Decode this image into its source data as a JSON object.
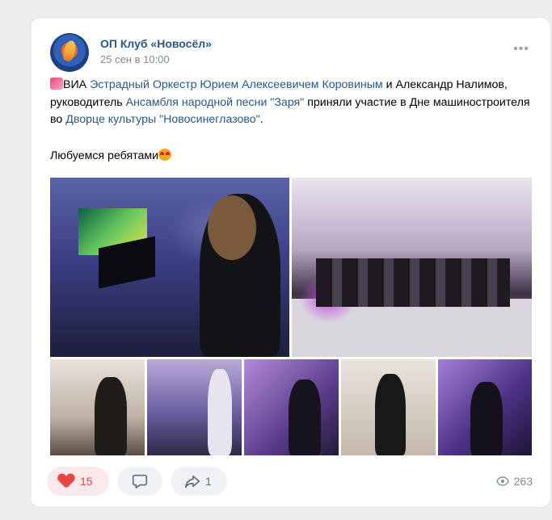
{
  "post": {
    "author": "ОП Клуб «Новосёл»",
    "date": "25 сен в 10:00",
    "more": "•••",
    "text": {
      "part1": "ВИА ",
      "link1": "Эстрадный Оркестр Юрием Алексеевичем Коровиным",
      "part2": " и Александр Налимов, руководитель ",
      "link2": "Ансамбля народной песни \"Заря\"",
      "part3": " приняли участие в Дне машиностроителя во ",
      "link3": "Дворце культуры \"Новосинеглазово\"",
      "part4": ".",
      "line2": "Любуемся ребятами"
    },
    "photos_count": 7
  },
  "actions": {
    "likes": "15",
    "shares": "1",
    "views": "263"
  },
  "colors": {
    "link": "#2a5885",
    "like_accent": "#e64646",
    "background": "#edeef0"
  },
  "icons": [
    "music-emoji-icon",
    "heart-eyes-emoji-icon",
    "heart-icon",
    "comment-icon",
    "share-icon",
    "eye-icon",
    "more-icon"
  ]
}
